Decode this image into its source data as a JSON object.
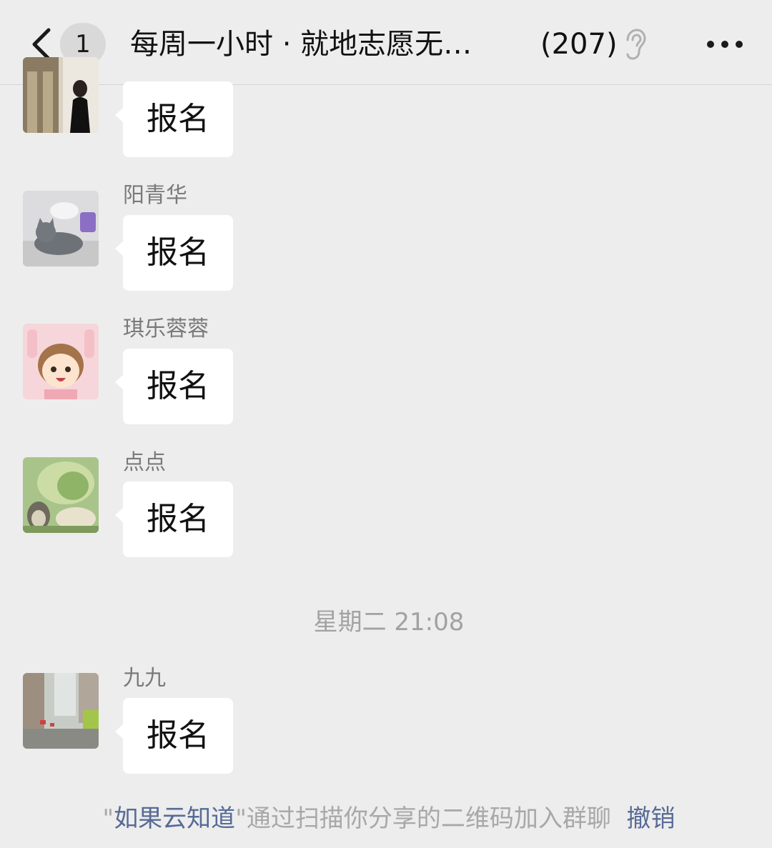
{
  "topbar": {
    "unread_count": "1",
    "title": "每周一小时 · 就地志愿无…",
    "member_count": "(207)"
  },
  "messages": [
    {
      "sender": "",
      "text": "报名"
    },
    {
      "sender": "阳青华",
      "text": "报名"
    },
    {
      "sender": "琪乐蓉蓉",
      "text": "报名"
    },
    {
      "sender": "点点",
      "text": "报名"
    },
    {
      "sender": "九九",
      "text": "报名"
    }
  ],
  "timestamp": "星期二 21:08",
  "system_notice": {
    "quote_open": "\"",
    "user_name": "如果云知道",
    "rest": "\"通过扫描你分享的二维码加入群聊",
    "revoke_label": "撤销"
  },
  "colors": {
    "background": "#ededed",
    "bubble": "#ffffff",
    "link": "#576b95"
  },
  "icons": [
    "back-arrow-icon",
    "ear-icon",
    "more-icon"
  ]
}
